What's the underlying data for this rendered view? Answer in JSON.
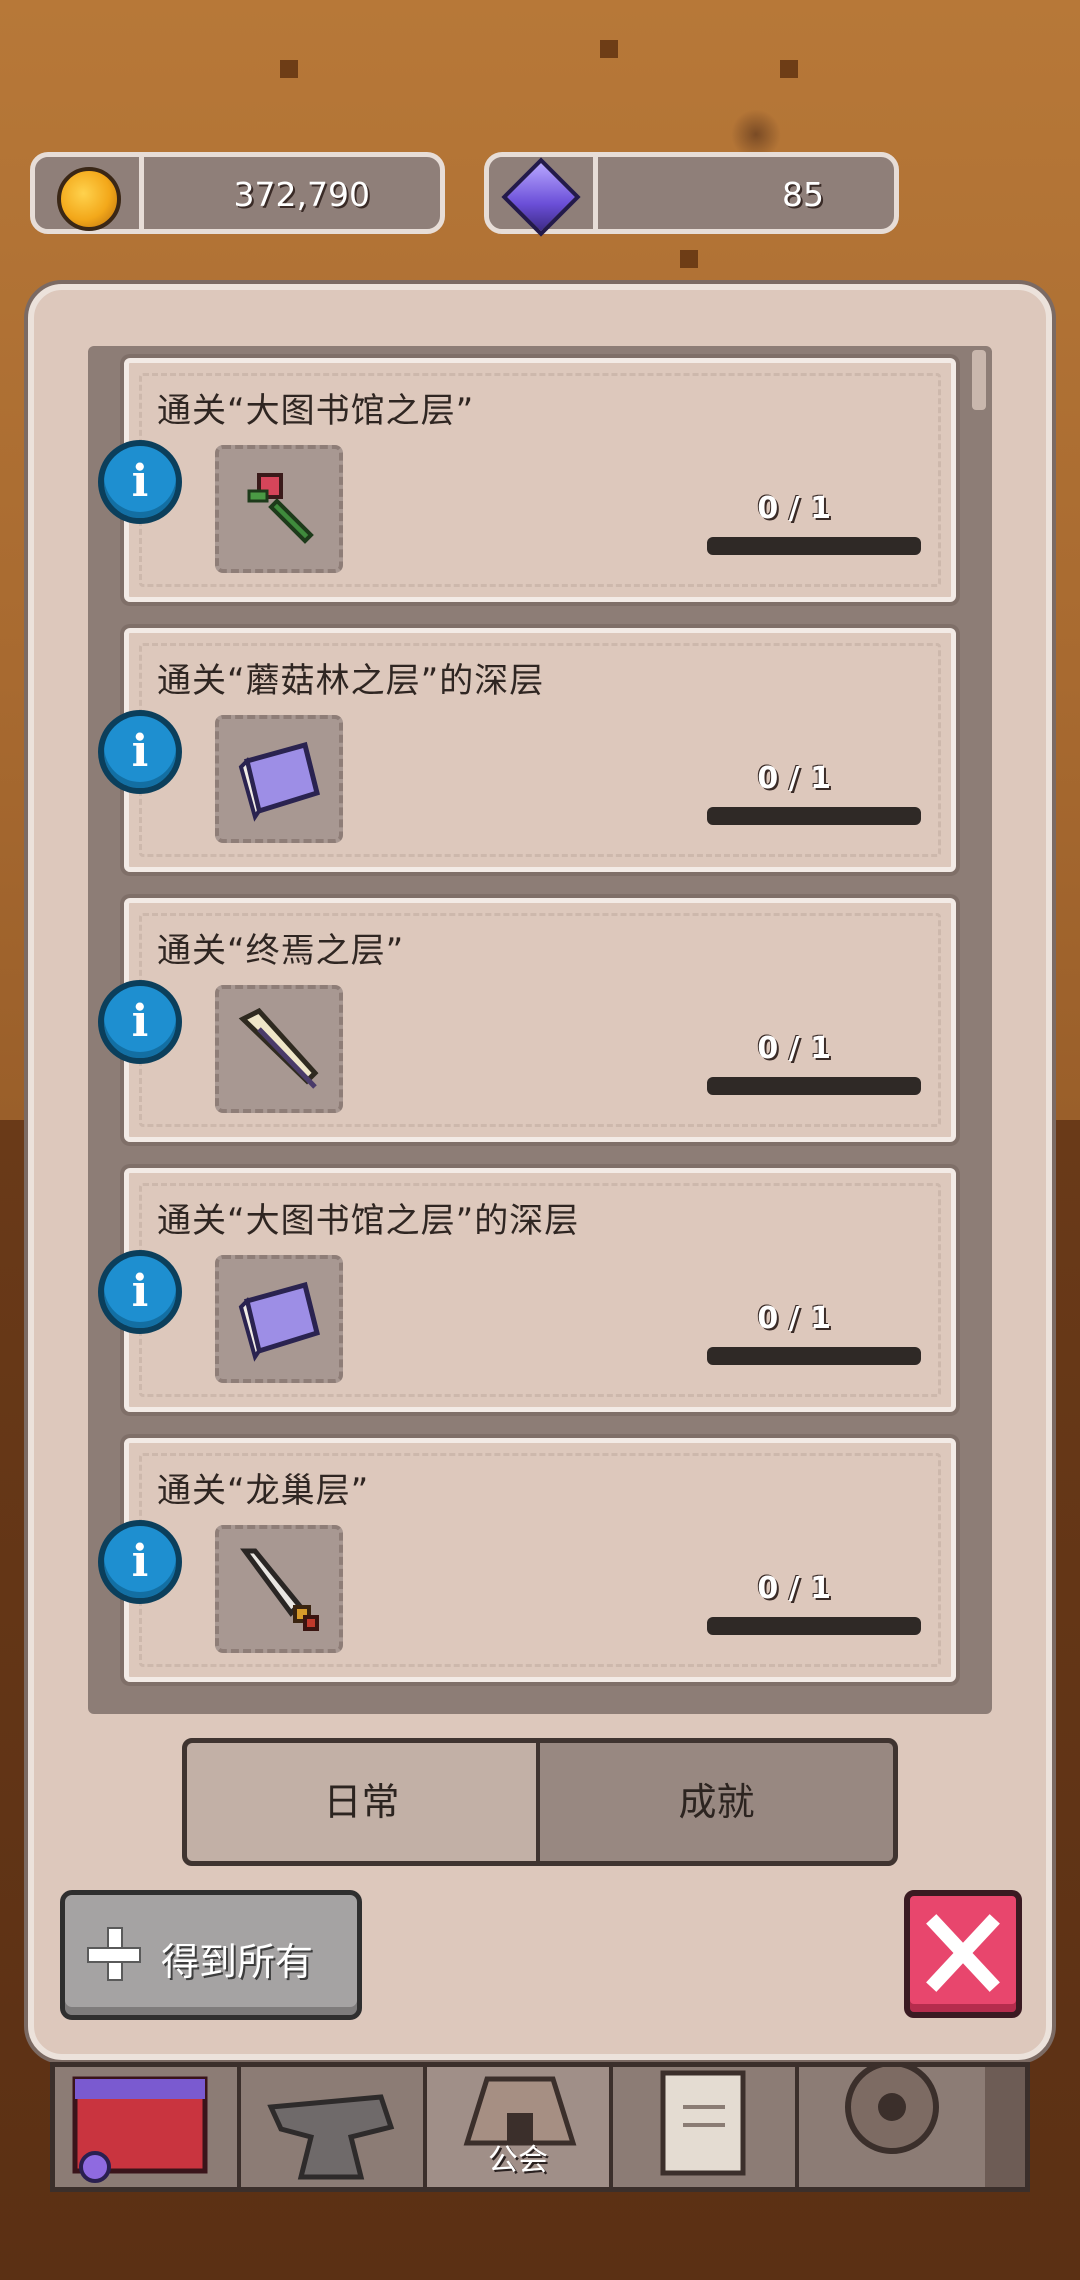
{
  "currency": {
    "gold": {
      "icon": "gold-coin-icon",
      "value": "372,790"
    },
    "gems": {
      "icon": "purple-gem-icon",
      "value": "85"
    }
  },
  "quests": [
    {
      "title": "通关“大图书馆之层”",
      "item_icon": "rose-icon",
      "progress": "0 / 1",
      "fraction": 0
    },
    {
      "title": "通关“蘑菇林之层”的深层",
      "item_icon": "purple-book-icon",
      "progress": "0 / 1",
      "fraction": 0
    },
    {
      "title": "通关“终焉之层”",
      "item_icon": "feather-icon",
      "progress": "0 / 1",
      "fraction": 0
    },
    {
      "title": "通关“大图书馆之层”的深层",
      "item_icon": "purple-book-icon",
      "progress": "0 / 1",
      "fraction": 0
    },
    {
      "title": "通关“龙巢层”",
      "item_icon": "dagger-icon",
      "progress": "0 / 1",
      "fraction": 0
    }
  ],
  "tabs": {
    "daily": "日常",
    "achievements": "成就",
    "selected": "daily"
  },
  "actions": {
    "get_all": "得到所有"
  },
  "nav": {
    "guild_label": "公会"
  },
  "colors": {
    "info_blue": "#1e8fd0",
    "close_red": "#e8466d",
    "panel": "#ddc8bc"
  }
}
